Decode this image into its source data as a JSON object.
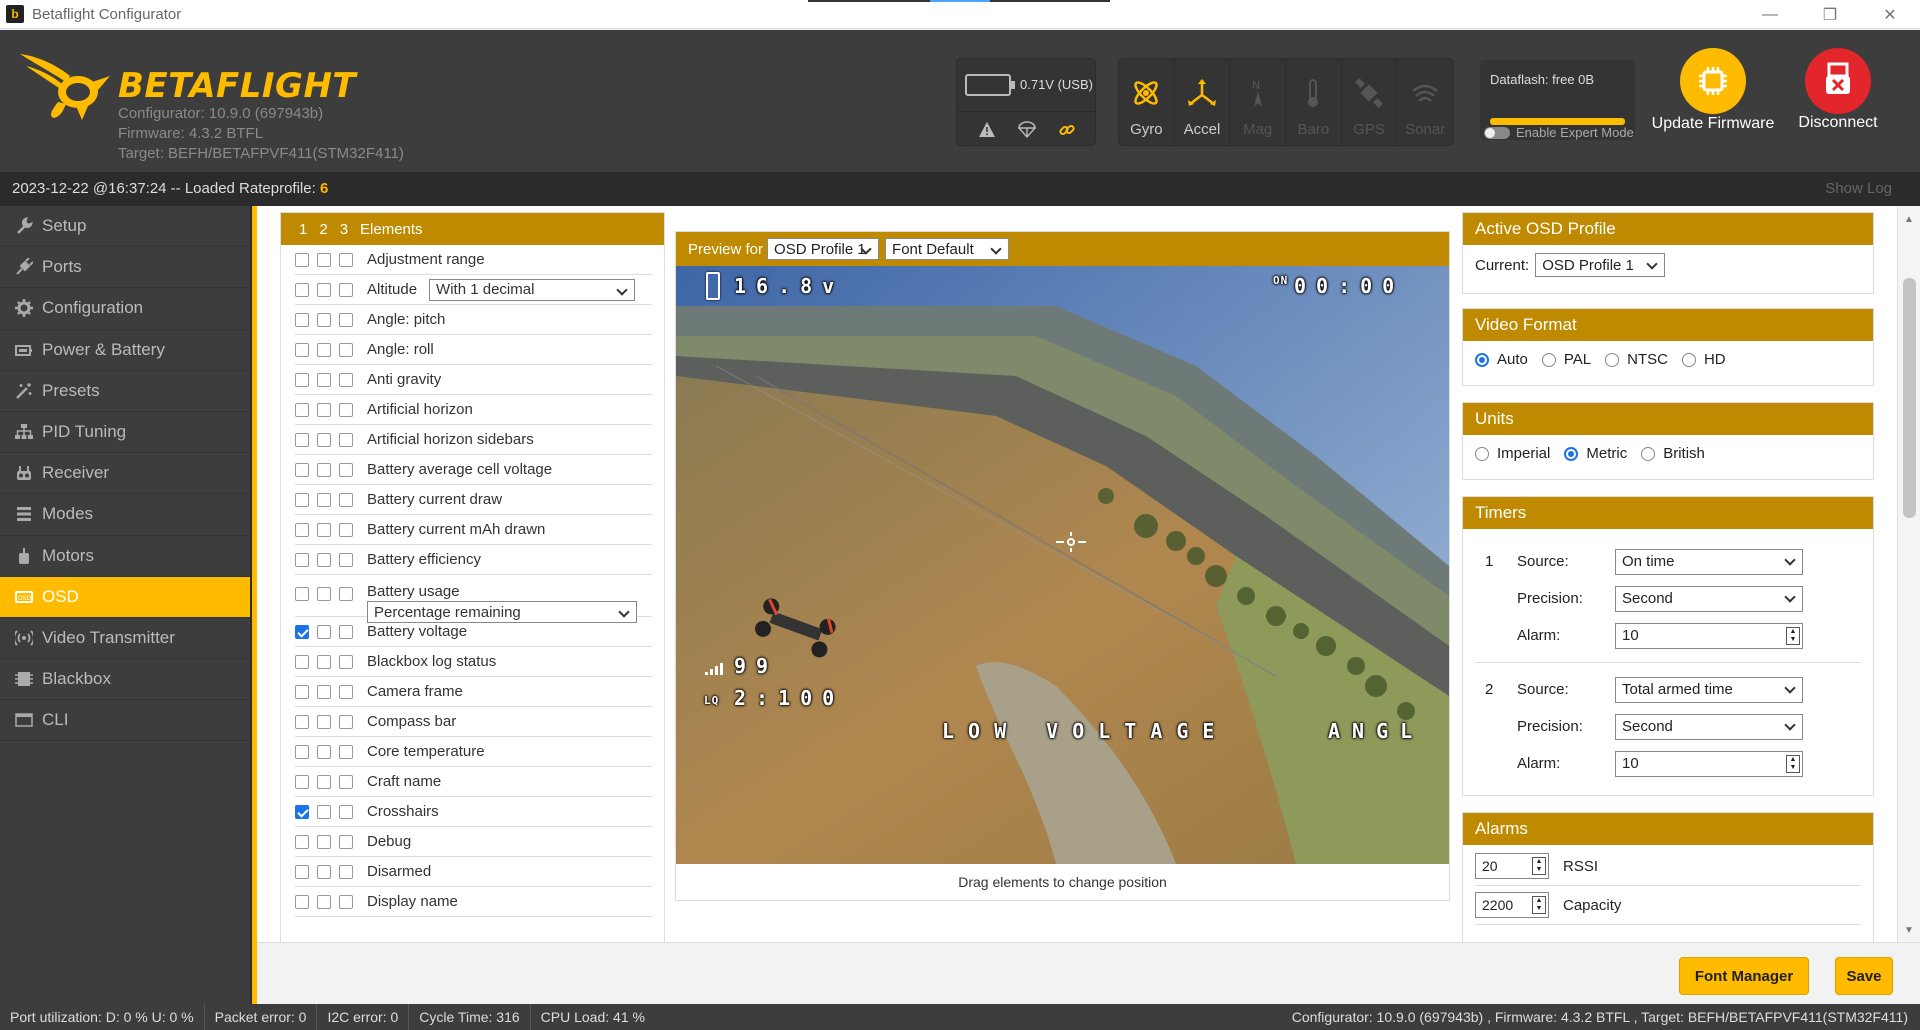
{
  "window": {
    "title": "Betaflight Configurator",
    "minimize": "—",
    "maximize": "❐",
    "close": "✕"
  },
  "header": {
    "brand": "BETAFLIGHT",
    "configurator": "Configurator: 10.9.0 (697943b)",
    "firmware": "Firmware: 4.3.2 BTFL",
    "target": "Target: BEFH/BETAFPVF411(STM32F411)",
    "battery_voltage": "0.71V (USB)",
    "sensors": [
      {
        "label": "Gyro",
        "icon": "gyro-icon",
        "active": true
      },
      {
        "label": "Accel",
        "icon": "accel-icon",
        "active": true
      },
      {
        "label": "Mag",
        "icon": "mag-icon",
        "active": false
      },
      {
        "label": "Baro",
        "icon": "baro-icon",
        "active": false
      },
      {
        "label": "GPS",
        "icon": "gps-icon",
        "active": false
      },
      {
        "label": "Sonar",
        "icon": "sonar-icon",
        "active": false
      }
    ],
    "dataflash": "Dataflash: free 0B",
    "expert_mode": "Enable Expert Mode",
    "update_firmware": "Update Firmware",
    "disconnect": "Disconnect"
  },
  "log": {
    "message": "2023-12-22 @16:37:24 -- Loaded Rateprofile: ",
    "profile": "6",
    "show_log": "Show Log"
  },
  "sidebar": {
    "items": [
      {
        "label": "Setup",
        "icon": "wrench-icon"
      },
      {
        "label": "Ports",
        "icon": "plug-icon"
      },
      {
        "label": "Configuration",
        "icon": "gear-icon"
      },
      {
        "label": "Power & Battery",
        "icon": "battery-icon"
      },
      {
        "label": "Presets",
        "icon": "magic-icon"
      },
      {
        "label": "PID Tuning",
        "icon": "sitemap-icon"
      },
      {
        "label": "Receiver",
        "icon": "receiver-icon"
      },
      {
        "label": "Modes",
        "icon": "modes-icon"
      },
      {
        "label": "Motors",
        "icon": "motor-icon"
      },
      {
        "label": "OSD",
        "icon": "osd-icon"
      },
      {
        "label": "Video Transmitter",
        "icon": "vtx-icon"
      },
      {
        "label": "Blackbox",
        "icon": "blackbox-icon"
      },
      {
        "label": "CLI",
        "icon": "cli-icon"
      }
    ],
    "active": "OSD"
  },
  "elements": {
    "tabs": [
      "1",
      "2",
      "3",
      "Elements"
    ],
    "rows": [
      {
        "name": "Adjustment range",
        "checked": [
          false,
          false,
          false
        ]
      },
      {
        "name": "Altitude",
        "checked": [
          false,
          false,
          false
        ],
        "select": "With 1 decimal"
      },
      {
        "name": "Angle: pitch",
        "checked": [
          false,
          false,
          false
        ]
      },
      {
        "name": "Angle: roll",
        "checked": [
          false,
          false,
          false
        ]
      },
      {
        "name": "Anti gravity",
        "checked": [
          false,
          false,
          false
        ]
      },
      {
        "name": "Artificial horizon",
        "checked": [
          false,
          false,
          false
        ]
      },
      {
        "name": "Artificial horizon sidebars",
        "checked": [
          false,
          false,
          false
        ]
      },
      {
        "name": "Battery average cell voltage",
        "checked": [
          false,
          false,
          false
        ]
      },
      {
        "name": "Battery current draw",
        "checked": [
          false,
          false,
          false
        ]
      },
      {
        "name": "Battery current mAh drawn",
        "checked": [
          false,
          false,
          false
        ]
      },
      {
        "name": "Battery efficiency",
        "checked": [
          false,
          false,
          false
        ]
      },
      {
        "name": "Battery usage",
        "checked": [
          false,
          false,
          false
        ],
        "select": "Percentage remaining",
        "tall": true
      },
      {
        "name": "Battery voltage",
        "checked": [
          true,
          false,
          false
        ]
      },
      {
        "name": "Blackbox log status",
        "checked": [
          false,
          false,
          false
        ]
      },
      {
        "name": "Camera frame",
        "checked": [
          false,
          false,
          false
        ]
      },
      {
        "name": "Compass bar",
        "checked": [
          false,
          false,
          false
        ]
      },
      {
        "name": "Core temperature",
        "checked": [
          false,
          false,
          false
        ]
      },
      {
        "name": "Craft name",
        "checked": [
          false,
          false,
          false
        ]
      },
      {
        "name": "Crosshairs",
        "checked": [
          true,
          false,
          false
        ]
      },
      {
        "name": "Debug",
        "checked": [
          false,
          false,
          false
        ]
      },
      {
        "name": "Disarmed",
        "checked": [
          false,
          false,
          false
        ]
      },
      {
        "name": "Display name",
        "checked": [
          false,
          false,
          false
        ]
      }
    ]
  },
  "preview": {
    "label": "Preview for",
    "profile_select": "OSD Profile 1",
    "font_select": "Font Default",
    "caption": "Drag elements to change position",
    "osd": {
      "voltage": "16.8v",
      "timer": "00:00",
      "rssi": "99",
      "flytime": "2:100",
      "warning": "LOW VOLTAGE",
      "angle": "ANGL"
    }
  },
  "active_profile": {
    "title": "Active OSD Profile",
    "current_label": "Current:",
    "current": "OSD Profile 1"
  },
  "video_format": {
    "title": "Video Format",
    "options": [
      "Auto",
      "PAL",
      "NTSC",
      "HD"
    ],
    "selected": "Auto"
  },
  "units": {
    "title": "Units",
    "options": [
      "Imperial",
      "Metric",
      "British"
    ],
    "selected": "Metric"
  },
  "timers": {
    "title": "Timers",
    "items": [
      {
        "num": "1",
        "source_label": "Source:",
        "source": "On time",
        "precision_label": "Precision:",
        "precision": "Second",
        "alarm_label": "Alarm:",
        "alarm": "10"
      },
      {
        "num": "2",
        "source_label": "Source:",
        "source": "Total armed time",
        "precision_label": "Precision:",
        "precision": "Second",
        "alarm_label": "Alarm:",
        "alarm": "10"
      }
    ]
  },
  "alarms": {
    "title": "Alarms",
    "items": [
      {
        "value": "20",
        "label": "RSSI"
      },
      {
        "value": "2200",
        "label": "Capacity"
      }
    ]
  },
  "buttons": {
    "font_manager": "Font Manager",
    "save": "Save"
  },
  "status": {
    "port": "Port utilization: D: 0 % U: 0 %",
    "packet": "Packet error: 0",
    "i2c": "I2C error: 0",
    "cycle": "Cycle Time: 316",
    "cpu": "CPU Load: 41 %",
    "version": "Configurator: 10.9.0 (697943b) , Firmware: 4.3.2 BTFL , Target: BEFH/BETAFPVF411(STM32F411)"
  },
  "colors": {
    "accent": "#ffbb00",
    "panel_header": "#bf8a00",
    "dark": "#3d3d3d",
    "disconnect": "#e2262b",
    "checked": "#1a73e8"
  }
}
